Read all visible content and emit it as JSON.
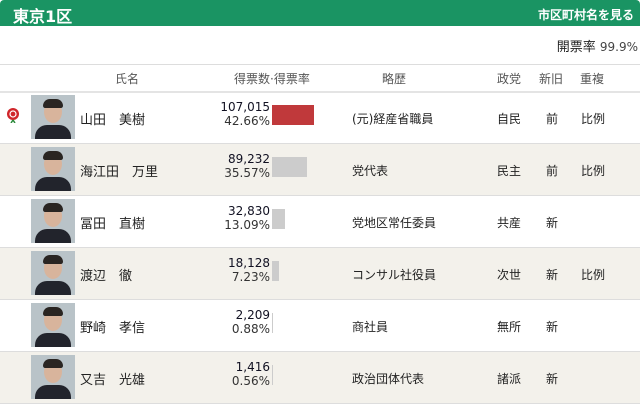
{
  "header": {
    "title": "東京1区",
    "link": "市区町村名を見る"
  },
  "counting": {
    "label": "開票率",
    "value": "99.9%"
  },
  "columns": {
    "name": "氏名",
    "votes": "得票数·得票率",
    "bio": "略歴",
    "party": "政党",
    "status": "新旧",
    "dual": "重複"
  },
  "accent": "#1a9463",
  "candidates": [
    {
      "name": "山田　美樹",
      "votes": "107,015",
      "pct": "42.66%",
      "share": 42.66,
      "bio": "(元)経産省職員",
      "party": "自民",
      "status": "前",
      "dual": "比例",
      "winner": true
    },
    {
      "name": "海江田　万里",
      "votes": "89,232",
      "pct": "35.57%",
      "share": 35.57,
      "bio": "党代表",
      "party": "民主",
      "status": "前",
      "dual": "比例"
    },
    {
      "name": "冨田　直樹",
      "votes": "32,830",
      "pct": "13.09%",
      "share": 13.09,
      "bio": "党地区常任委員",
      "party": "共産",
      "status": "新",
      "dual": ""
    },
    {
      "name": "渡辺　徹",
      "votes": "18,128",
      "pct": "7.23%",
      "share": 7.23,
      "bio": "コンサル社役員",
      "party": "次世",
      "status": "新",
      "dual": "比例"
    },
    {
      "name": "野崎　孝信",
      "votes": "2,209",
      "pct": "0.88%",
      "share": 0.88,
      "bio": "商社員",
      "party": "無所",
      "status": "新",
      "dual": ""
    },
    {
      "name": "又吉　光雄",
      "votes": "1,416",
      "pct": "0.56%",
      "share": 0.56,
      "bio": "政治団体代表",
      "party": "諸派",
      "status": "新",
      "dual": ""
    }
  ]
}
